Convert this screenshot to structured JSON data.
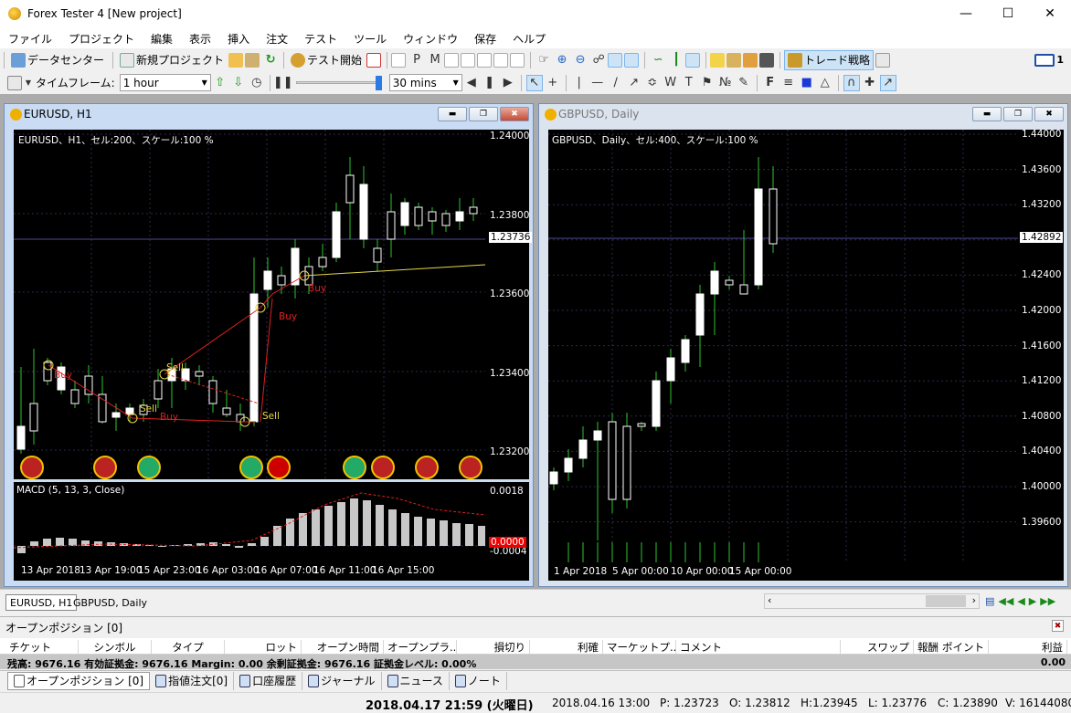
{
  "app": {
    "title": "Forex Tester 4  [New project]"
  },
  "menu": [
    "ファイル",
    "プロジェクト",
    "編集",
    "表示",
    "挿入",
    "注文",
    "テスト",
    "ツール",
    "ウィンドウ",
    "保存",
    "ヘルプ"
  ],
  "toolbar1": {
    "data_center": "データセンター",
    "new_project": "新規プロジェクト",
    "start_test": "テスト開始",
    "trade_strategy": "トレード戦略",
    "mail_count": "1"
  },
  "toolbar2": {
    "timeframe_label": "タイムフレーム:",
    "timeframe_value": "1 hour",
    "speed_value": "30 mins"
  },
  "chart1": {
    "title": "EURUSD, H1",
    "info": "EURUSD、H1、セル:200、スケール:100 %",
    "price_ticks": [
      "1.24000",
      "1.23800",
      "1.23600",
      "1.23400",
      "1.23200"
    ],
    "current_price": "1.23736",
    "indicator": "MACD (5, 13, 3, Close)",
    "macd_ticks": [
      "0.0018",
      "-0.0004"
    ],
    "macd_current": "0.0000",
    "time_ticks": [
      "13 Apr 2018",
      "13 Apr 19:00",
      "15 Apr 23:00",
      "16 Apr 03:00",
      "16 Apr 07:00",
      "16 Apr 11:00",
      "16 Apr 15:00"
    ],
    "trade_labels": [
      "Buy",
      "Sell",
      "Buy",
      "Sell",
      "Sell",
      "Buy",
      "Buy"
    ]
  },
  "chart2": {
    "title": "GBPUSD, Daily",
    "info": "GBPUSD、Daily、セル:400、スケール:100 %",
    "price_ticks": [
      "1.44000",
      "1.43600",
      "1.43200",
      "1.42800",
      "1.42400",
      "1.42000",
      "1.41600",
      "1.41200",
      "1.40800",
      "1.40400",
      "1.40000",
      "1.39600"
    ],
    "current_price": "1.42892",
    "time_ticks": [
      "1 Apr 2018",
      "5 Apr 00:00",
      "10 Apr 00:00",
      "15 Apr 00:00"
    ]
  },
  "chart_tabs": [
    "EURUSD, H1",
    "GBPUSD, Daily"
  ],
  "positions": {
    "header": "オープンポジション [0]",
    "columns": [
      "チケット",
      "シンボル",
      "タイプ",
      "ロット",
      "オープン時間",
      "オープンプラ...",
      "損切り",
      "利確",
      "マーケットプ...",
      "コメント",
      "スワップ",
      "報酬",
      "ポイント",
      "利益"
    ],
    "balance_row": "残高: 9676.16 有効証拠金: 9676.16 Margin: 0.00 余剰証拠金: 9676.16 証拠金レベル: 0.00%",
    "profit_total": "0.00"
  },
  "bottom_tabs": [
    "オープンポジション [0]",
    "指値注文[0]",
    "口座履歴",
    "ジャーナル",
    "ニュース",
    "ノート"
  ],
  "status": {
    "datetime": "2018.04.17 21:59 (火曜日)",
    "bar_time": "2018.04.16 13:00",
    "p": "P: 1.23723",
    "o": "O: 1.23812",
    "h": "H:1.23945",
    "l": "L: 1.23776",
    "c": "C: 1.23890",
    "v": "V: 16144080"
  }
}
